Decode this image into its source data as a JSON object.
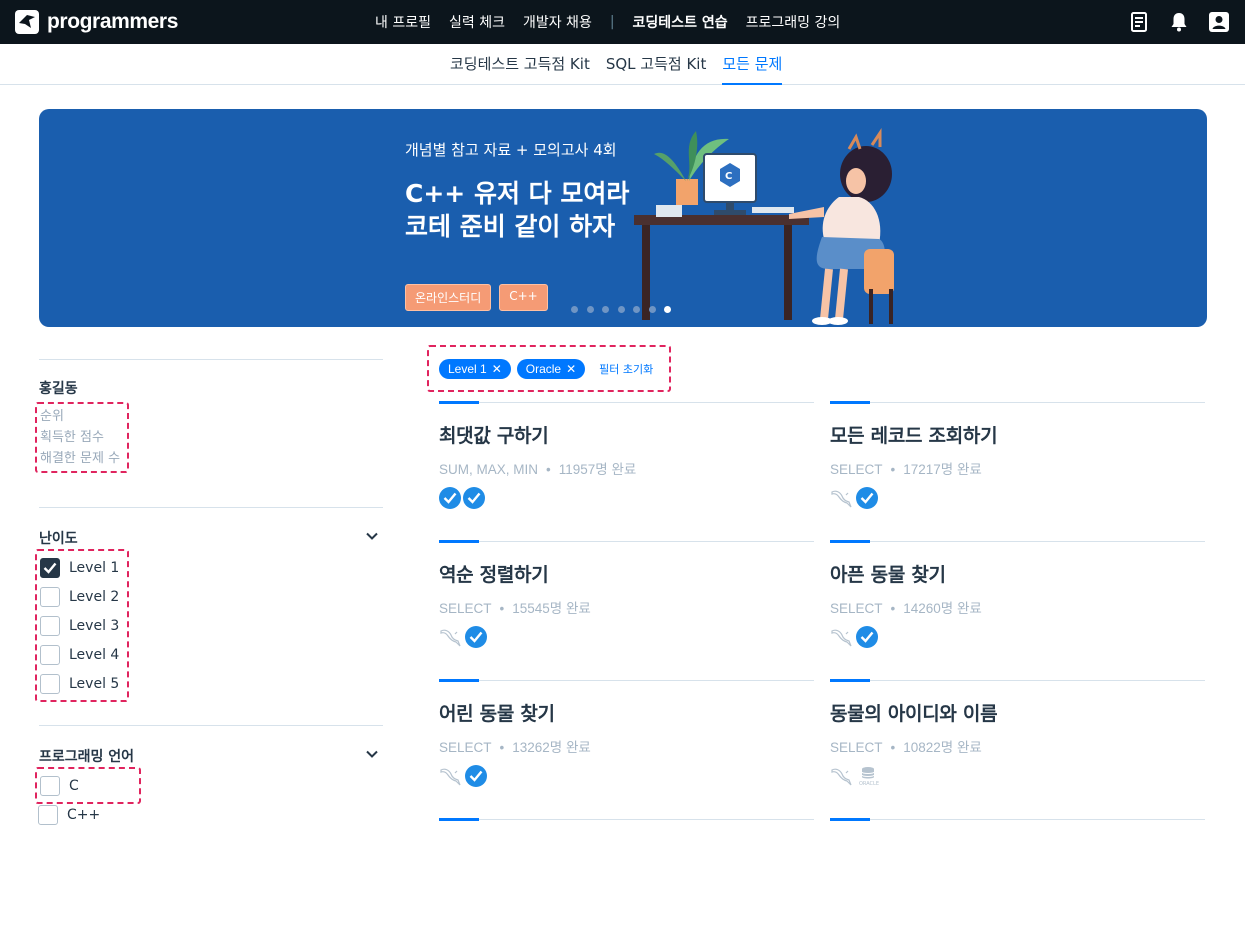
{
  "brand": {
    "logo_text": "programmers"
  },
  "nav": {
    "items": [
      {
        "label": "내 프로필",
        "active": false
      },
      {
        "label": "실력 체크",
        "active": false
      },
      {
        "label": "개발자 채용",
        "active": false
      }
    ],
    "separator": "|",
    "items_right": [
      {
        "label": "코딩테스트 연습",
        "active": true
      },
      {
        "label": "프로그래밍 강의",
        "active": false
      }
    ],
    "icons": [
      "document-icon",
      "bell-icon",
      "user-icon"
    ]
  },
  "subnav": {
    "items": [
      {
        "label": "코딩테스트 고득점 Kit",
        "active": false
      },
      {
        "label": "SQL 고득점 Kit",
        "active": false
      },
      {
        "label": "모든 문제",
        "active": true
      }
    ]
  },
  "banner": {
    "subtitle": "개념별 참고 자료 + 모의고사 4회",
    "title": "C++ 유저 다 모여라\n코테 준비 같이 하자",
    "tags": [
      "온라인스터디",
      "C++"
    ],
    "dots_count": 7,
    "active_dot": 6,
    "colors": {
      "background": "#1a5eae",
      "tag": "#f59b75"
    }
  },
  "user": {
    "name": "홍길동",
    "stats": [
      "순위",
      "획득한 점수",
      "해결한 문제 수"
    ]
  },
  "filters": {
    "difficulty": {
      "title": "난이도",
      "options": [
        {
          "label": "Level 1",
          "checked": true
        },
        {
          "label": "Level 2",
          "checked": false
        },
        {
          "label": "Level 3",
          "checked": false
        },
        {
          "label": "Level 4",
          "checked": false
        },
        {
          "label": "Level 5",
          "checked": false
        }
      ]
    },
    "language": {
      "title": "프로그래밍 언어",
      "options": [
        {
          "label": "C",
          "checked": false
        },
        {
          "label": "C++",
          "checked": false
        }
      ]
    }
  },
  "active_filters": {
    "chips": [
      "Level 1",
      "Oracle"
    ],
    "reset_label": "필터 초기화"
  },
  "problems": [
    {
      "title": "최댓값 구하기",
      "tags": "SUM, MAX, MIN",
      "solved": "11957명 완료",
      "icons": [
        "check",
        "check"
      ]
    },
    {
      "title": "모든 레코드 조회하기",
      "tags": "SELECT",
      "solved": "17217명 완료",
      "icons": [
        "mysql",
        "check"
      ]
    },
    {
      "title": "역순 정렬하기",
      "tags": "SELECT",
      "solved": "15545명 완료",
      "icons": [
        "mysql",
        "check"
      ]
    },
    {
      "title": "아픈 동물 찾기",
      "tags": "SELECT",
      "solved": "14260명 완료",
      "icons": [
        "mysql",
        "check"
      ]
    },
    {
      "title": "어린 동물 찾기",
      "tags": "SELECT",
      "solved": "13262명 완료",
      "icons": [
        "mysql",
        "check"
      ]
    },
    {
      "title": "동물의 아이디와 이름",
      "tags": "SELECT",
      "solved": "10822명 완료",
      "icons": [
        "mysql",
        "oracle"
      ]
    }
  ],
  "colors": {
    "accent": "#0078ff",
    "nav_bg": "#0c151c",
    "check": "#1f8ce6",
    "highlight": "#e0245e"
  }
}
